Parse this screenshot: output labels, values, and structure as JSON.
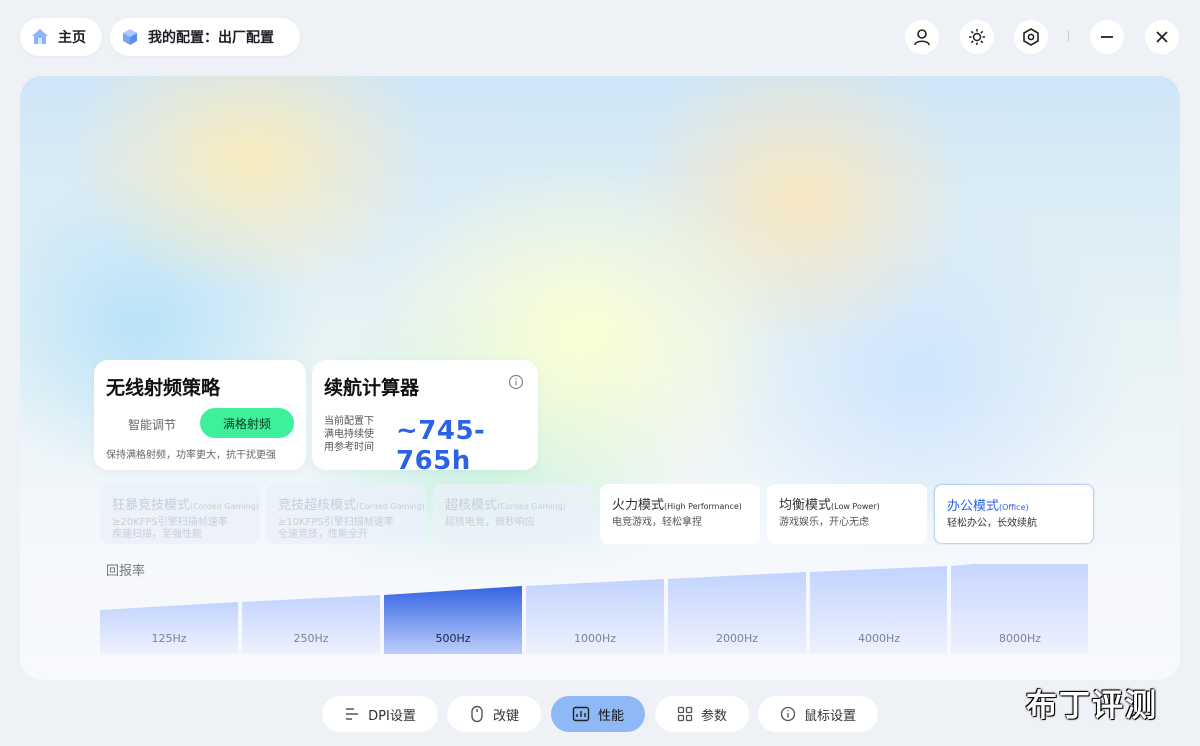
{
  "topbar": {
    "home_label": "主页",
    "config_label": "我的配置：出厂配置",
    "icons": [
      "user-icon",
      "brightness-icon",
      "settings-hex-icon",
      "minimize-icon",
      "close-icon"
    ]
  },
  "rf_card": {
    "title": "无线射频策略",
    "option_smart": "智能调节",
    "option_full": "满格射频",
    "selected": "满格射频",
    "description": "保持满格射频，功率更大，抗干扰更强"
  },
  "battery_card": {
    "title": "续航计算器",
    "label_lines": [
      "当前配置下",
      "满电持续使",
      "用参考时间"
    ],
    "value": "~745-765h"
  },
  "modes": [
    {
      "name": "狂暴竞技模式",
      "en": "(Corded Gaming)",
      "desc1": "≥20KFPS引擎扫描帧速率",
      "desc2": "疾速扫描，至强性能",
      "state": "disabled"
    },
    {
      "name": "竞技超核模式",
      "en": "(Corded Gaming)",
      "desc1": "≥10KFPS引擎扫描帧速率",
      "desc2": "全速竞技，性能全开",
      "state": "disabled"
    },
    {
      "name": "超核模式",
      "en": "(Corded Gaming)",
      "desc1": "超核电竞，微秒响应",
      "desc2": "",
      "state": "disabled"
    },
    {
      "name": "火力模式",
      "en": "(High Performance)",
      "desc1": "电竞游戏，轻松拿捏",
      "desc2": "",
      "state": "enabled"
    },
    {
      "name": "均衡模式",
      "en": "(Low Power)",
      "desc1": "游戏娱乐，开心无虑",
      "desc2": "",
      "state": "enabled"
    },
    {
      "name": "办公模式",
      "en": "(Office)",
      "desc1": "轻松办公，长效续航",
      "desc2": "",
      "state": "active"
    }
  ],
  "polling": {
    "label": "回报率",
    "rates": [
      "125Hz",
      "250Hz",
      "500Hz",
      "1000Hz",
      "2000Hz",
      "4000Hz",
      "8000Hz"
    ],
    "selected": "500Hz"
  },
  "bottom_nav": [
    {
      "label": "DPI设置",
      "icon": "dpi-icon"
    },
    {
      "label": "改键",
      "icon": "mouse-icon"
    },
    {
      "label": "性能",
      "icon": "performance-icon",
      "active": true
    },
    {
      "label": "参数",
      "icon": "grid-icon"
    },
    {
      "label": "鼠标设置",
      "icon": "info-icon"
    }
  ],
  "watermark": "布丁评测",
  "colors": {
    "accent": "#2c62e8",
    "toggle_active": "#3ef09a",
    "nav_active": "#8fb8f6",
    "bar_selected": "#3d6be6",
    "bar_default": "#c9d8ff"
  }
}
